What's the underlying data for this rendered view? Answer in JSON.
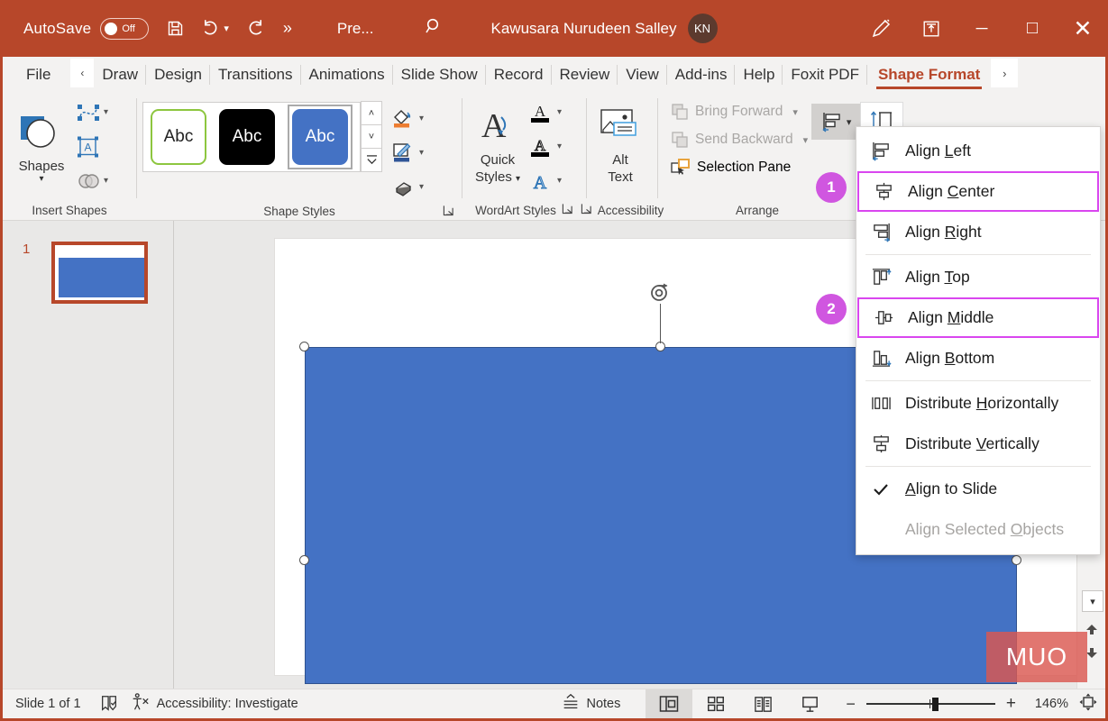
{
  "titlebar": {
    "autosave_label": "AutoSave",
    "autosave_state": "Off",
    "save_icon": "save-icon",
    "undo_icon": "undo-icon",
    "redo_icon": "redo-icon",
    "more_label": "»",
    "presentation_name": "Pre...",
    "search_icon": "search-icon",
    "user_name": "Kawusara Nurudeen Salley",
    "user_initials": "KN",
    "pen_icon": "pen-icon",
    "ribbon_display_icon": "ribbon-display-options-icon",
    "minimize_label": "─",
    "maximize_label": "□",
    "close_label": "✕",
    "bg_color": "#b7472a"
  },
  "tabs": [
    {
      "label": "File",
      "active": false
    },
    {
      "label": "Draw",
      "active": false
    },
    {
      "label": "Design",
      "active": false
    },
    {
      "label": "Transitions",
      "active": false
    },
    {
      "label": "Animations",
      "active": false
    },
    {
      "label": "Slide Show",
      "active": false
    },
    {
      "label": "Record",
      "active": false
    },
    {
      "label": "Review",
      "active": false
    },
    {
      "label": "View",
      "active": false
    },
    {
      "label": "Add-ins",
      "active": false
    },
    {
      "label": "Help",
      "active": false
    },
    {
      "label": "Foxit PDF",
      "active": false
    },
    {
      "label": "Shape Format",
      "active": true
    }
  ],
  "tabrow": {
    "collapse_label": "‹",
    "expand_label": "›"
  },
  "ribbon": {
    "groups": [
      {
        "caption": "Insert Shapes"
      },
      {
        "caption": "Shape Styles"
      },
      {
        "caption": "WordArt Styles"
      },
      {
        "caption": "Accessibility"
      },
      {
        "caption": "Arrange"
      }
    ],
    "insert_shapes": {
      "shapes_label": "Shapes",
      "edit_shape_icon": "edit-shape-icon",
      "text_box_icon": "text-box-icon",
      "merge_shapes_icon": "merge-shapes-icon"
    },
    "shape_styles": {
      "tiles": [
        {
          "label": "Abc",
          "variant": "outline-green"
        },
        {
          "label": "Abc",
          "variant": "filled-black"
        },
        {
          "label": "Abc",
          "variant": "filled-blue-selected"
        }
      ],
      "scroll_up": "˄",
      "scroll_down": "˅",
      "more": "⩒",
      "shape_fill_icon": "shape-fill-icon",
      "shape_outline_icon": "shape-outline-icon",
      "shape_effects_icon": "shape-effects-icon",
      "dialog_launcher": "dialog-box-launcher"
    },
    "wordart_styles": {
      "quick_label_line1": "Quick",
      "quick_label_line2": "Styles",
      "text_fill_icon": "text-fill-icon",
      "text_outline_icon": "text-outline-icon",
      "text_effects_icon": "text-effects-icon",
      "dialog_launcher": "dialog-box-launcher"
    },
    "accessibility": {
      "alt_line1": "Alt",
      "alt_line2": "Text"
    },
    "arrange": {
      "bring_forward": "Bring Forward",
      "send_backward": "Send Backward",
      "selection_pane": "Selection Pane",
      "align_button_icon": "align-objects-icon",
      "size_button_icon": "size-icon"
    }
  },
  "align_menu": {
    "items": [
      {
        "label": "Align Left",
        "mnemonic": "L",
        "icon": "align-left-icon",
        "state": "normal",
        "highlight": false
      },
      {
        "label": "Align Center",
        "mnemonic": "C",
        "icon": "align-center-icon",
        "state": "normal",
        "highlight": true
      },
      {
        "label": "Align Right",
        "mnemonic": "R",
        "icon": "align-right-icon",
        "state": "normal",
        "highlight": false
      },
      {
        "label": "Align Top",
        "mnemonic": "T",
        "icon": "align-top-icon",
        "state": "normal",
        "highlight": false
      },
      {
        "label": "Align Middle",
        "mnemonic": "M",
        "icon": "align-middle-icon",
        "state": "normal",
        "highlight": true
      },
      {
        "label": "Align Bottom",
        "mnemonic": "B",
        "icon": "align-bottom-icon",
        "state": "normal",
        "highlight": false
      },
      {
        "label": "Distribute Horizontally",
        "mnemonic": "H",
        "icon": "distribute-horizontal-icon",
        "state": "normal",
        "highlight": false
      },
      {
        "label": "Distribute Vertically",
        "mnemonic": "V",
        "icon": "distribute-vertical-icon",
        "state": "normal",
        "highlight": false
      },
      {
        "label": "Align to Slide",
        "mnemonic": "A",
        "icon": "checkmark-icon",
        "state": "checked",
        "highlight": false
      },
      {
        "label": "Align Selected Objects",
        "mnemonic": "O",
        "icon": "none",
        "state": "disabled",
        "highlight": false
      }
    ],
    "highlight_color": "#d946ef"
  },
  "callouts": [
    {
      "number": "1"
    },
    {
      "number": "2"
    }
  ],
  "slide_panel": {
    "slide_number": "1"
  },
  "slide": {
    "shape_fill": "#4472c4",
    "shape_outline": "#2f528f",
    "rotate_handle_icon": "rotate-handle-icon"
  },
  "statusbar": {
    "slide_count": "Slide 1 of 1",
    "language_icon": "spell-check-icon",
    "accessibility_icon": "accessibility-icon",
    "accessibility_label": "Accessibility: Investigate",
    "notes_label": "Notes",
    "notes_icon": "notes-icon",
    "views": [
      {
        "name": "normal-view",
        "active": true
      },
      {
        "name": "slide-sorter-view",
        "active": false
      },
      {
        "name": "reading-view",
        "active": false
      },
      {
        "name": "slide-show-view",
        "active": false
      }
    ],
    "zoom_out_label": "−",
    "zoom_in_label": "+",
    "zoom_value": "146%",
    "fit_icon": "fit-to-window-icon"
  },
  "watermark": {
    "text": "MUO"
  }
}
